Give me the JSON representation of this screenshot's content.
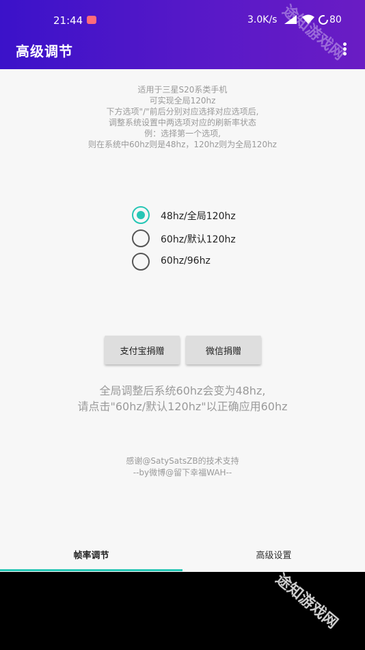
{
  "status": {
    "time": "21:44",
    "net_speed": "3.0K/s",
    "battery": "80"
  },
  "app_bar": {
    "title": "高级调节"
  },
  "intro": {
    "lines": [
      "适用于三星S20系类手机",
      "可实现全局120hz",
      "下方选项\"/\"前后分别对应选择对应选项后,",
      "调整系统设置中两选项对应的刷新率状态",
      "例：选择第一个选项,",
      "则在系统中60hz则是48hz，120hz则为全局120hz"
    ]
  },
  "options": [
    {
      "label": "48hz/全局120hz",
      "checked": true
    },
    {
      "label": "60hz/默认120hz",
      "checked": false
    },
    {
      "label": "60hz/96hz",
      "checked": false
    }
  ],
  "buttons": {
    "alipay": "支付宝捐赠",
    "wechat": "微信捐赠"
  },
  "notice": {
    "lines": [
      "全局调整后系统60hz会变为48hz,",
      "请点击\"60hz/默认120hz\"以正确应用60hz"
    ]
  },
  "credits": {
    "lines": [
      "感谢@SatySatsZB的技术支持",
      "--by微博@留下幸福WAH--"
    ]
  },
  "tabs": [
    {
      "label": "帧率调节",
      "active": true
    },
    {
      "label": "高级设置",
      "active": false
    }
  ],
  "watermark": "途知游戏网",
  "colors": {
    "accent": "#26c6b5",
    "app_bar": "#5a19c8",
    "background": "#f7f7f7"
  }
}
